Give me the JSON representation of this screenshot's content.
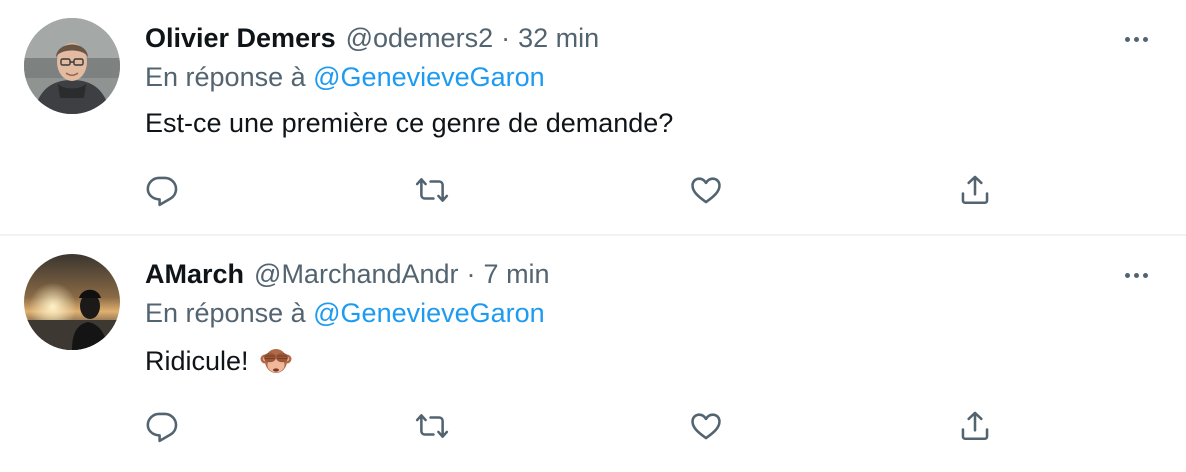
{
  "colors": {
    "text_primary": "#0f1419",
    "text_secondary": "#536471",
    "link": "#1d9bf0",
    "divider": "#eff3f4"
  },
  "tweets": [
    {
      "name": "Olivier Demers",
      "handle": "@odemers2",
      "separator": "·",
      "time": "32 min",
      "reply_prefix": "En réponse à",
      "reply_to": "@GenevieveGaron",
      "text": "Est-ce une première ce genre de demande?",
      "emoji": "",
      "avatar_icon": "person-portrait-avatar",
      "action_icons": [
        "reply-icon",
        "retweet-icon",
        "like-icon",
        "share-icon"
      ]
    },
    {
      "name": "AMarch",
      "handle": "@MarchandAndr",
      "separator": "·",
      "time": "7 min",
      "reply_prefix": "En réponse à",
      "reply_to": "@GenevieveGaron",
      "text": "Ridicule!",
      "emoji": "see-no-evil-monkey",
      "avatar_icon": "sunset-silhouette-avatar",
      "action_icons": [
        "reply-icon",
        "retweet-icon",
        "like-icon",
        "share-icon"
      ]
    }
  ]
}
